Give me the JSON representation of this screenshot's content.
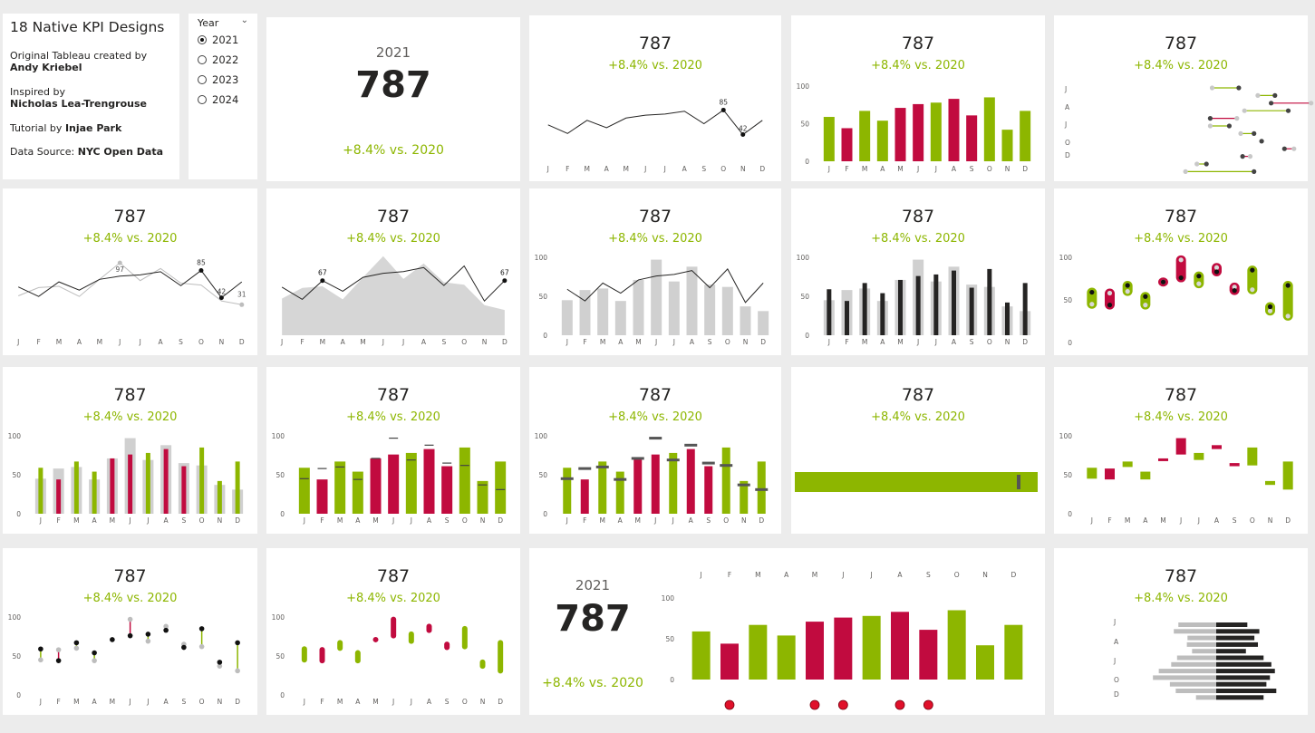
{
  "info": {
    "title": "18 Native KPI Designs",
    "created_prefix": "Original Tableau created by",
    "created_by": "Andy Kriebel",
    "inspired_prefix": "Inspired by",
    "inspired_by": "Nicholas Lea-Trengrouse",
    "tutorial_prefix": "Tutorial by ",
    "tutorial_by": "Injae Park",
    "source_prefix": "Data Source: ",
    "source": "NYC Open Data"
  },
  "year_slicer": {
    "title": "Year",
    "selected": "2021",
    "options": [
      "2021",
      "2022",
      "2023",
      "2024"
    ]
  },
  "kpi": {
    "year": "2021",
    "value": "787",
    "delta": "+8.4% vs. 2020"
  },
  "colors": {
    "positive": "#8db600",
    "negative": "#c10b3f",
    "prior": "#c8c8c8",
    "current": "#252423"
  },
  "chart_data": {
    "type": "bar",
    "months": [
      "J",
      "F",
      "M",
      "A",
      "M",
      "J",
      "J",
      "A",
      "S",
      "O",
      "N",
      "D"
    ],
    "months_short": [
      "J",
      "A",
      "J",
      "O",
      "D"
    ],
    "current_year": [
      59,
      44,
      67,
      54,
      71,
      76,
      78,
      83,
      61,
      85,
      42,
      67
    ],
    "prior_year": [
      45,
      58,
      60,
      44,
      71,
      97,
      69,
      88,
      65,
      62,
      37,
      31
    ],
    "status": [
      "pos",
      "neg",
      "pos",
      "pos",
      "neg",
      "neg",
      "pos",
      "neg",
      "neg",
      "pos",
      "pos",
      "pos"
    ],
    "y_ticks": [
      0,
      50,
      100
    ],
    "ylim": [
      0,
      100
    ],
    "labels": {
      "line_high": "85",
      "line_low": "42",
      "prior_high": "97",
      "prior_last": "31",
      "area_first": "67",
      "area_last": "67"
    }
  }
}
